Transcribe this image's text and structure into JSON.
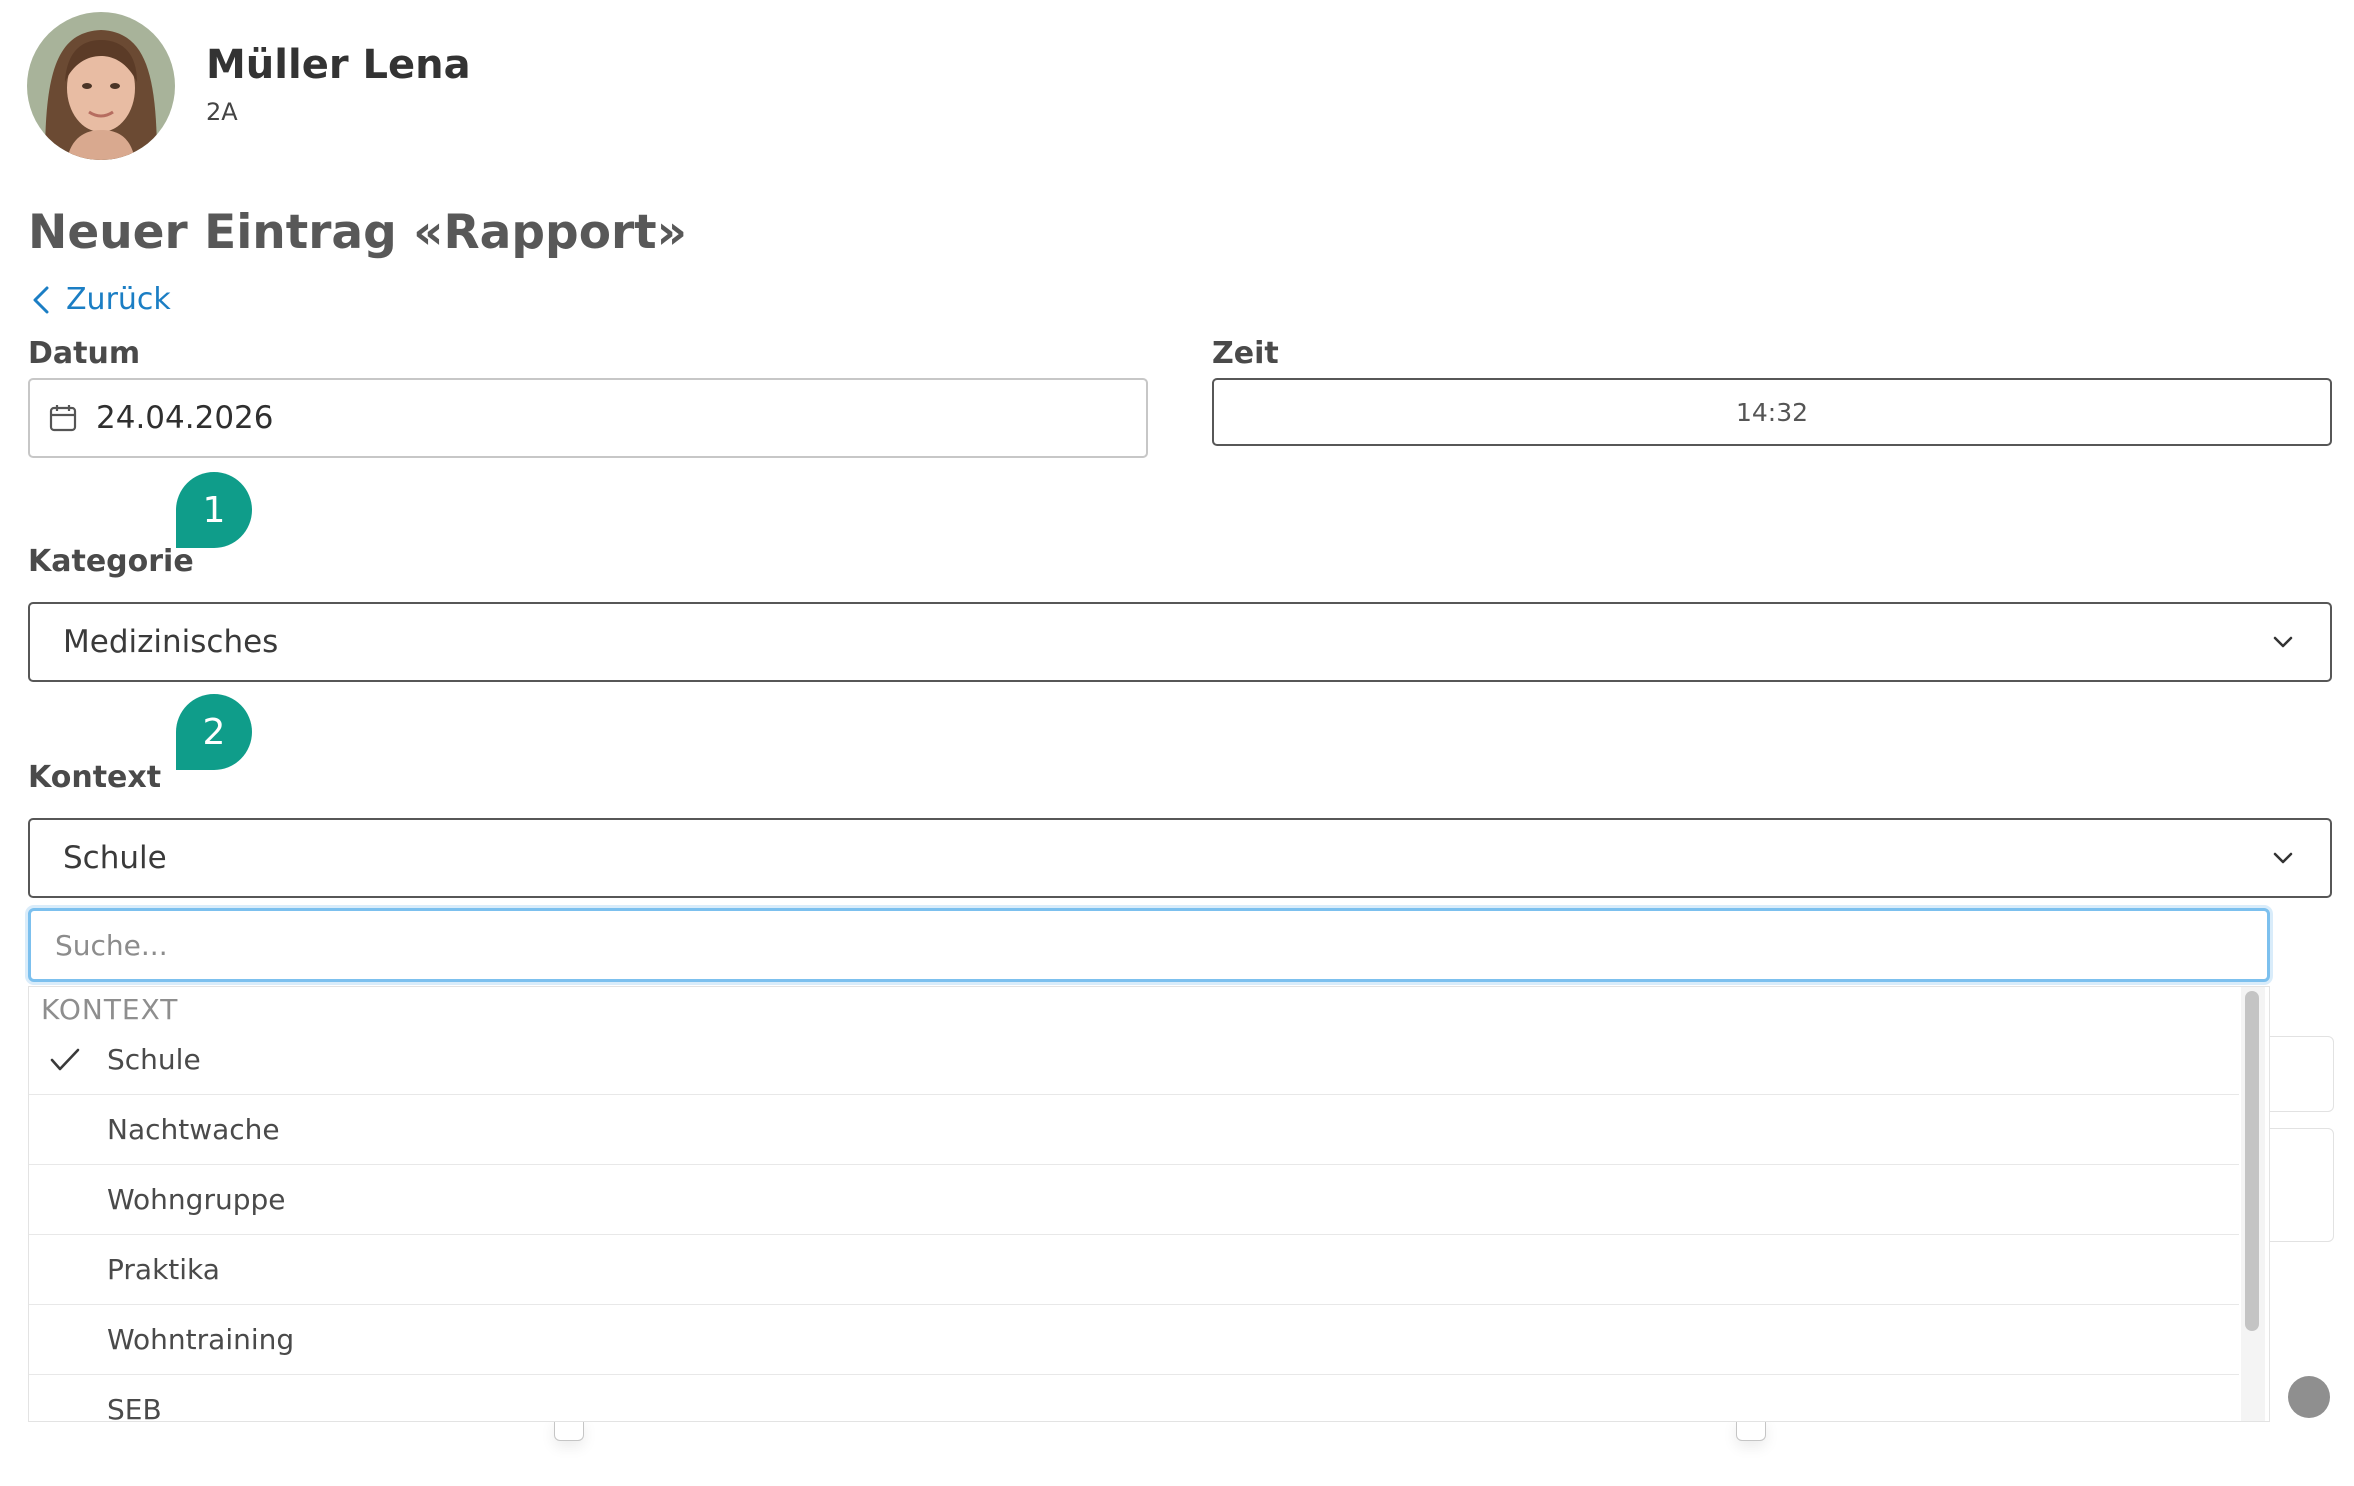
{
  "student": {
    "name": "Müller Lena",
    "class": "2A"
  },
  "page": {
    "title": "Neuer Eintrag «Rapport»",
    "back_label": "Zurück"
  },
  "form": {
    "date_label": "Datum",
    "date_value": "24.04.2026",
    "time_label": "Zeit",
    "time_value": "14:32",
    "category_label": "Kategorie",
    "category_value": "Medizinisches",
    "context_label": "Kontext",
    "context_value": "Schule"
  },
  "markers": [
    "1",
    "2"
  ],
  "dropdown": {
    "search_placeholder": "Suche...",
    "group_label": "KONTEXT",
    "options": [
      {
        "label": "Schule",
        "selected": true
      },
      {
        "label": "Nachtwache",
        "selected": false
      },
      {
        "label": "Wohngruppe",
        "selected": false
      },
      {
        "label": "Praktika",
        "selected": false
      },
      {
        "label": "Wohntraining",
        "selected": false
      },
      {
        "label": "SEB",
        "selected": false
      }
    ]
  },
  "colors": {
    "accent": "#0f9d8a",
    "link": "#1b7ec4",
    "focus": "#7cc0ee"
  }
}
